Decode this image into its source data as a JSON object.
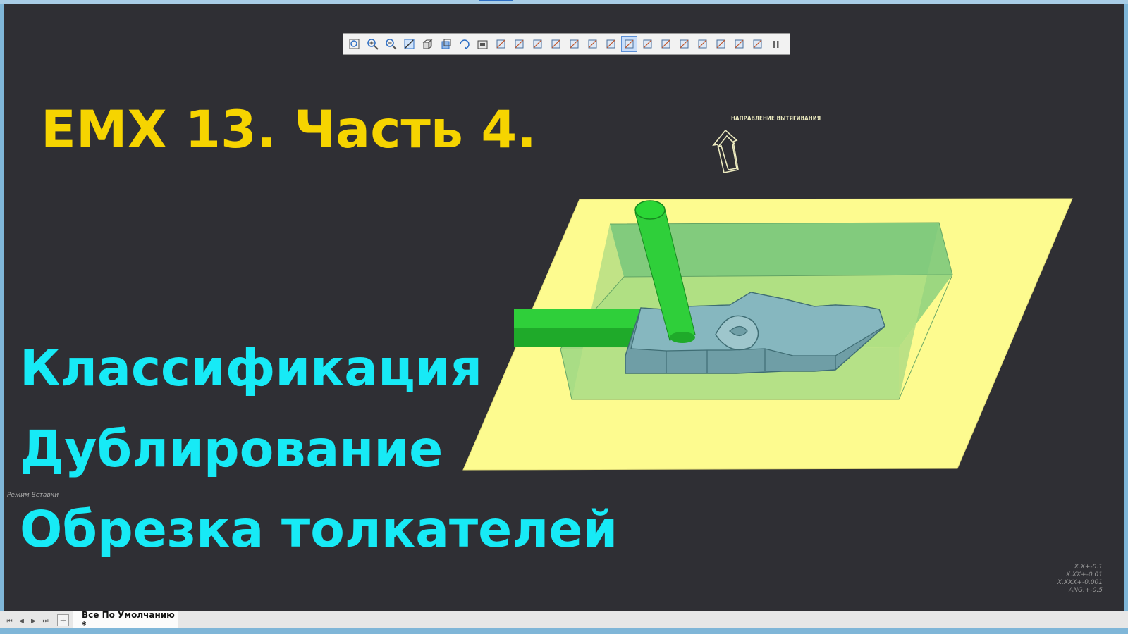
{
  "toolbar": {
    "buttons": [
      {
        "icon": "zoom-fit-icon"
      },
      {
        "icon": "zoom-in-icon"
      },
      {
        "icon": "zoom-out-icon"
      },
      {
        "icon": "zoom-window-icon"
      },
      {
        "icon": "named-views-icon"
      },
      {
        "icon": "display-style-icon"
      },
      {
        "icon": "spin-center-icon"
      },
      {
        "icon": "saved-views-icon"
      },
      {
        "icon": "datum-axis-display-icon"
      },
      {
        "icon": "datum-plane-display-icon"
      },
      {
        "icon": "datum-point-display-icon"
      },
      {
        "icon": "coordinate-system-display-icon"
      },
      {
        "icon": "csys-display-icon"
      },
      {
        "icon": "annotation-display-icon"
      },
      {
        "icon": "perspective-view-icon"
      },
      {
        "icon": "selection-filter-icon",
        "active": true
      },
      {
        "icon": "explode-icon"
      },
      {
        "icon": "section-icon"
      },
      {
        "icon": "appearance-icon"
      },
      {
        "icon": "render-icon"
      },
      {
        "icon": "layer-icon"
      },
      {
        "icon": "hidden-line-icon"
      },
      {
        "icon": "model-tree-icon"
      },
      {
        "icon": "pause-icon"
      }
    ]
  },
  "title": "EMX 13. Часть 4.",
  "topics": [
    "Классификация",
    "Дублирование",
    "Обрезка толкателей"
  ],
  "viewport": {
    "pull_direction_label": "НАПРАВЛЕНИЕ ВЫТЯГИВАНИЯ",
    "mode_label": "Режим Вставки",
    "tolerances": [
      "X.X+-0.1",
      "X.XX+-0.01",
      "X.XXX+-0.001",
      "ANG.+-0.5"
    ]
  },
  "status_bar": {
    "nav_buttons": [
      "⏮",
      "◀",
      "▶",
      "⏭"
    ],
    "add_tab": "+",
    "layout_tab": "Все По Умолчанию *"
  },
  "colors": {
    "background": "#2f2f34",
    "title": "#f6d400",
    "topics": "#17eaf6",
    "parting_plane": "#fdfb8f",
    "mold_block": "#6cc27a",
    "part": "#6f9ea6",
    "pin": "#2fcf3a"
  }
}
